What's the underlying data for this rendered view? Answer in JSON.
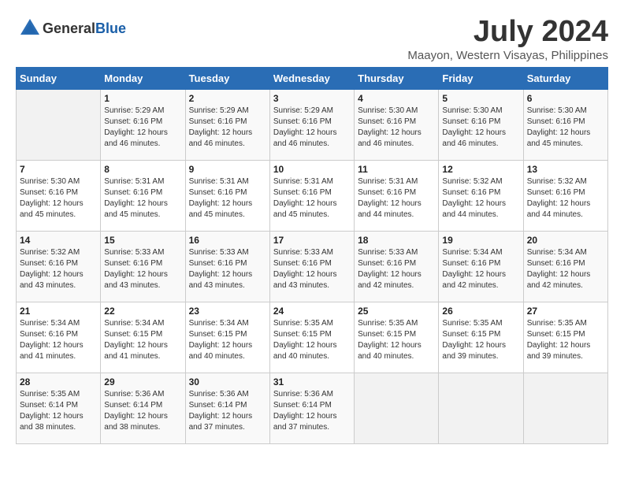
{
  "header": {
    "logo": {
      "text_general": "General",
      "text_blue": "Blue"
    },
    "month_year": "July 2024",
    "location": "Maayon, Western Visayas, Philippines"
  },
  "days_of_week": [
    "Sunday",
    "Monday",
    "Tuesday",
    "Wednesday",
    "Thursday",
    "Friday",
    "Saturday"
  ],
  "weeks": [
    [
      {
        "day": "",
        "empty": true
      },
      {
        "day": "1",
        "sunrise": "Sunrise: 5:29 AM",
        "sunset": "Sunset: 6:16 PM",
        "daylight": "Daylight: 12 hours and 46 minutes."
      },
      {
        "day": "2",
        "sunrise": "Sunrise: 5:29 AM",
        "sunset": "Sunset: 6:16 PM",
        "daylight": "Daylight: 12 hours and 46 minutes."
      },
      {
        "day": "3",
        "sunrise": "Sunrise: 5:29 AM",
        "sunset": "Sunset: 6:16 PM",
        "daylight": "Daylight: 12 hours and 46 minutes."
      },
      {
        "day": "4",
        "sunrise": "Sunrise: 5:30 AM",
        "sunset": "Sunset: 6:16 PM",
        "daylight": "Daylight: 12 hours and 46 minutes."
      },
      {
        "day": "5",
        "sunrise": "Sunrise: 5:30 AM",
        "sunset": "Sunset: 6:16 PM",
        "daylight": "Daylight: 12 hours and 46 minutes."
      },
      {
        "day": "6",
        "sunrise": "Sunrise: 5:30 AM",
        "sunset": "Sunset: 6:16 PM",
        "daylight": "Daylight: 12 hours and 45 minutes."
      }
    ],
    [
      {
        "day": "7",
        "sunrise": "Sunrise: 5:30 AM",
        "sunset": "Sunset: 6:16 PM",
        "daylight": "Daylight: 12 hours and 45 minutes."
      },
      {
        "day": "8",
        "sunrise": "Sunrise: 5:31 AM",
        "sunset": "Sunset: 6:16 PM",
        "daylight": "Daylight: 12 hours and 45 minutes."
      },
      {
        "day": "9",
        "sunrise": "Sunrise: 5:31 AM",
        "sunset": "Sunset: 6:16 PM",
        "daylight": "Daylight: 12 hours and 45 minutes."
      },
      {
        "day": "10",
        "sunrise": "Sunrise: 5:31 AM",
        "sunset": "Sunset: 6:16 PM",
        "daylight": "Daylight: 12 hours and 45 minutes."
      },
      {
        "day": "11",
        "sunrise": "Sunrise: 5:31 AM",
        "sunset": "Sunset: 6:16 PM",
        "daylight": "Daylight: 12 hours and 44 minutes."
      },
      {
        "day": "12",
        "sunrise": "Sunrise: 5:32 AM",
        "sunset": "Sunset: 6:16 PM",
        "daylight": "Daylight: 12 hours and 44 minutes."
      },
      {
        "day": "13",
        "sunrise": "Sunrise: 5:32 AM",
        "sunset": "Sunset: 6:16 PM",
        "daylight": "Daylight: 12 hours and 44 minutes."
      }
    ],
    [
      {
        "day": "14",
        "sunrise": "Sunrise: 5:32 AM",
        "sunset": "Sunset: 6:16 PM",
        "daylight": "Daylight: 12 hours and 43 minutes."
      },
      {
        "day": "15",
        "sunrise": "Sunrise: 5:33 AM",
        "sunset": "Sunset: 6:16 PM",
        "daylight": "Daylight: 12 hours and 43 minutes."
      },
      {
        "day": "16",
        "sunrise": "Sunrise: 5:33 AM",
        "sunset": "Sunset: 6:16 PM",
        "daylight": "Daylight: 12 hours and 43 minutes."
      },
      {
        "day": "17",
        "sunrise": "Sunrise: 5:33 AM",
        "sunset": "Sunset: 6:16 PM",
        "daylight": "Daylight: 12 hours and 43 minutes."
      },
      {
        "day": "18",
        "sunrise": "Sunrise: 5:33 AM",
        "sunset": "Sunset: 6:16 PM",
        "daylight": "Daylight: 12 hours and 42 minutes."
      },
      {
        "day": "19",
        "sunrise": "Sunrise: 5:34 AM",
        "sunset": "Sunset: 6:16 PM",
        "daylight": "Daylight: 12 hours and 42 minutes."
      },
      {
        "day": "20",
        "sunrise": "Sunrise: 5:34 AM",
        "sunset": "Sunset: 6:16 PM",
        "daylight": "Daylight: 12 hours and 42 minutes."
      }
    ],
    [
      {
        "day": "21",
        "sunrise": "Sunrise: 5:34 AM",
        "sunset": "Sunset: 6:16 PM",
        "daylight": "Daylight: 12 hours and 41 minutes."
      },
      {
        "day": "22",
        "sunrise": "Sunrise: 5:34 AM",
        "sunset": "Sunset: 6:15 PM",
        "daylight": "Daylight: 12 hours and 41 minutes."
      },
      {
        "day": "23",
        "sunrise": "Sunrise: 5:34 AM",
        "sunset": "Sunset: 6:15 PM",
        "daylight": "Daylight: 12 hours and 40 minutes."
      },
      {
        "day": "24",
        "sunrise": "Sunrise: 5:35 AM",
        "sunset": "Sunset: 6:15 PM",
        "daylight": "Daylight: 12 hours and 40 minutes."
      },
      {
        "day": "25",
        "sunrise": "Sunrise: 5:35 AM",
        "sunset": "Sunset: 6:15 PM",
        "daylight": "Daylight: 12 hours and 40 minutes."
      },
      {
        "day": "26",
        "sunrise": "Sunrise: 5:35 AM",
        "sunset": "Sunset: 6:15 PM",
        "daylight": "Daylight: 12 hours and 39 minutes."
      },
      {
        "day": "27",
        "sunrise": "Sunrise: 5:35 AM",
        "sunset": "Sunset: 6:15 PM",
        "daylight": "Daylight: 12 hours and 39 minutes."
      }
    ],
    [
      {
        "day": "28",
        "sunrise": "Sunrise: 5:35 AM",
        "sunset": "Sunset: 6:14 PM",
        "daylight": "Daylight: 12 hours and 38 minutes."
      },
      {
        "day": "29",
        "sunrise": "Sunrise: 5:36 AM",
        "sunset": "Sunset: 6:14 PM",
        "daylight": "Daylight: 12 hours and 38 minutes."
      },
      {
        "day": "30",
        "sunrise": "Sunrise: 5:36 AM",
        "sunset": "Sunset: 6:14 PM",
        "daylight": "Daylight: 12 hours and 37 minutes."
      },
      {
        "day": "31",
        "sunrise": "Sunrise: 5:36 AM",
        "sunset": "Sunset: 6:14 PM",
        "daylight": "Daylight: 12 hours and 37 minutes."
      },
      {
        "day": "",
        "empty": true
      },
      {
        "day": "",
        "empty": true
      },
      {
        "day": "",
        "empty": true
      }
    ]
  ]
}
